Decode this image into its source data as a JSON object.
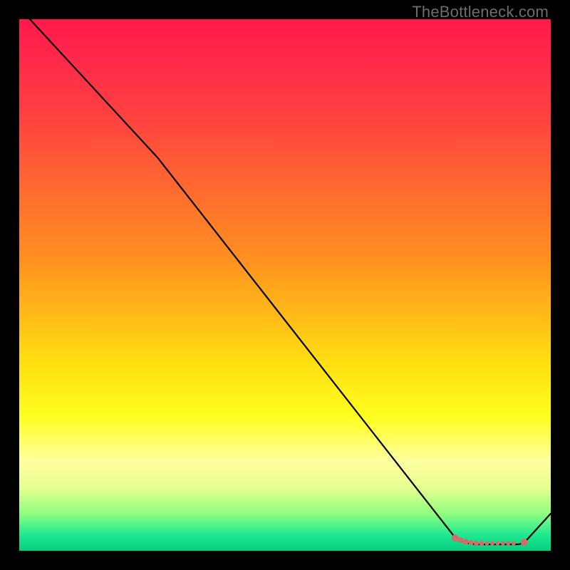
{
  "watermark": "TheBottleneck.com",
  "chart_data": {
    "type": "line",
    "title": "",
    "xlabel": "",
    "ylabel": "",
    "xlim": [
      0,
      100
    ],
    "ylim": [
      0,
      100
    ],
    "grid": false,
    "legend": false,
    "series": [
      {
        "name": "curve",
        "x": [
          2,
          26,
          82,
          84,
          86,
          87,
          88,
          89,
          90,
          91,
          92,
          93,
          94,
          95,
          100
        ],
        "y": [
          100,
          74,
          2.5,
          1.5,
          1.2,
          1.2,
          1.2,
          1.2,
          1.2,
          1.2,
          1.2,
          1.2,
          1.2,
          1.5,
          7
        ]
      }
    ],
    "markers": {
      "name": "dots",
      "color": "#d76b6b",
      "x": [
        82,
        83,
        84,
        85,
        86,
        87,
        88,
        89,
        90,
        91,
        92,
        93,
        95
      ],
      "y": [
        2.4,
        2.0,
        1.7,
        1.5,
        1.4,
        1.4,
        1.4,
        1.4,
        1.4,
        1.4,
        1.4,
        1.4,
        1.6
      ],
      "r": [
        5,
        4,
        4,
        3.5,
        3.5,
        3.5,
        3,
        3,
        3,
        3,
        3,
        3,
        5
      ]
    },
    "background_gradient": {
      "top": "#ff1a4a",
      "mid": "#ffff20",
      "bottom": "#00d080"
    }
  }
}
